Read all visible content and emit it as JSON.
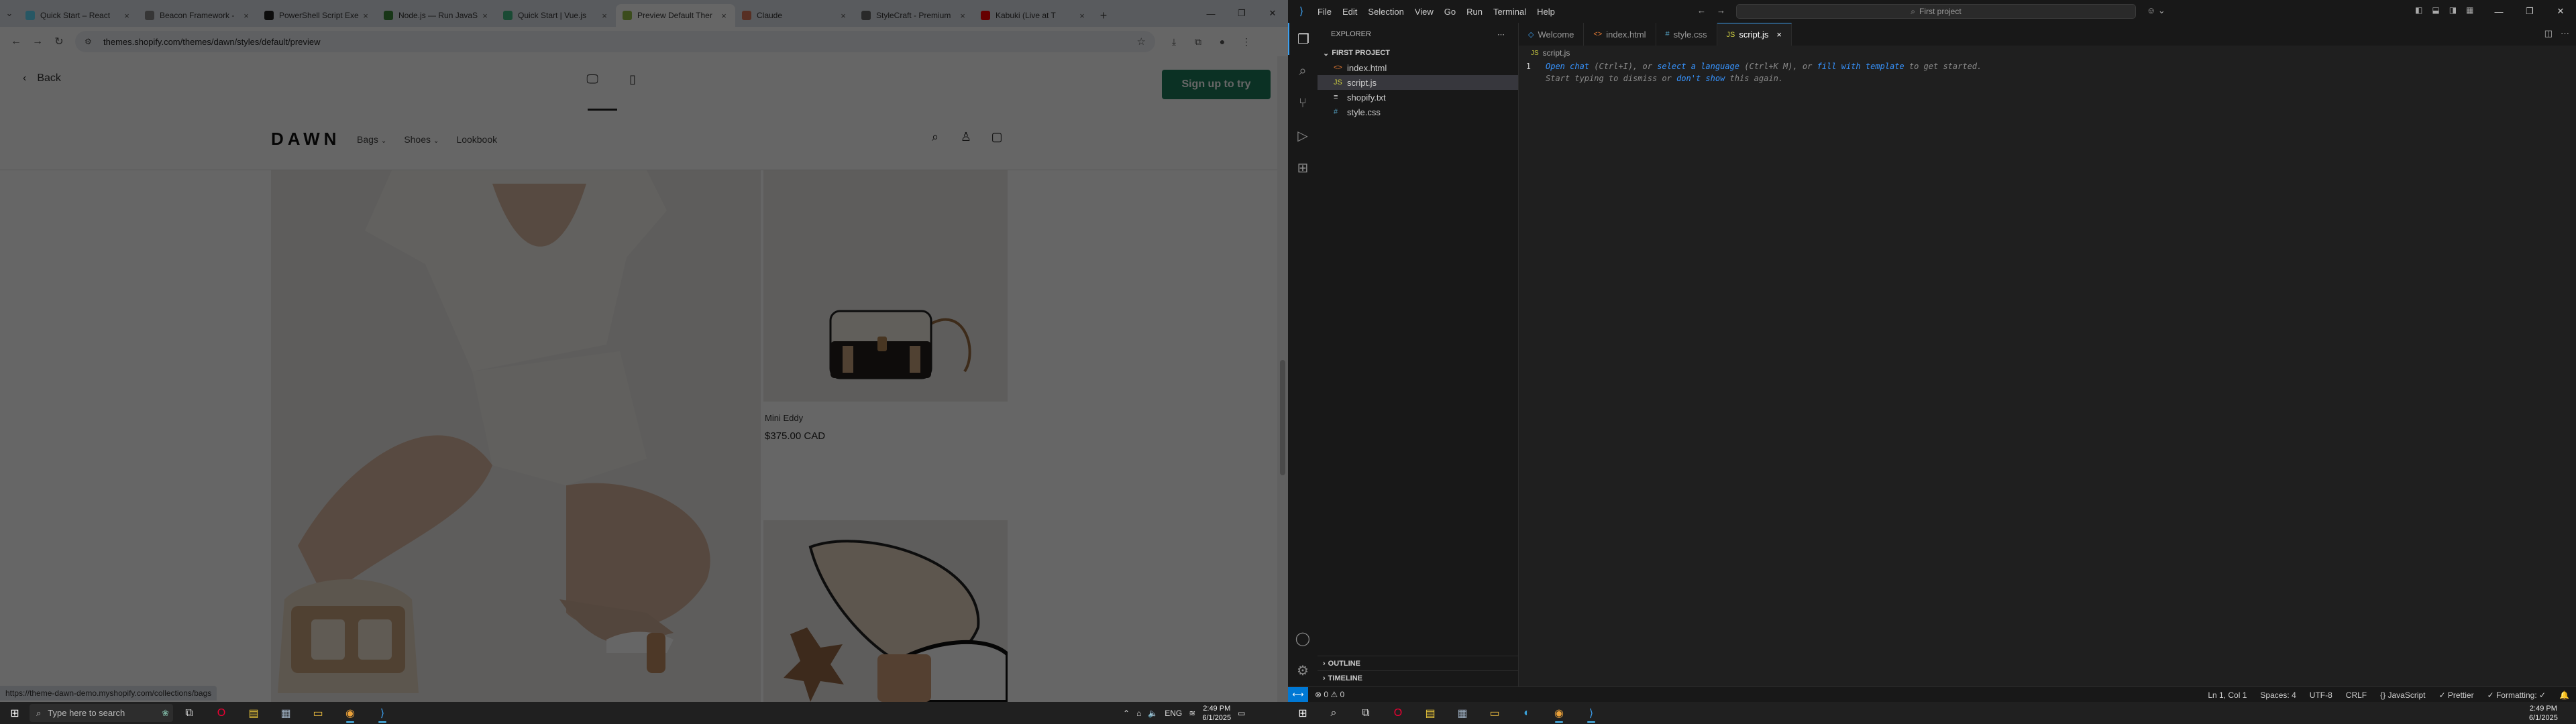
{
  "chrome": {
    "tabs": [
      {
        "title": "Quick Start – React",
        "favicon_color": "#61dafb",
        "active": false
      },
      {
        "title": "Beacon Framework -",
        "favicon_color": "#888888",
        "active": false
      },
      {
        "title": "PowerShell Script Exe",
        "favicon_color": "#222222",
        "active": false
      },
      {
        "title": "Node.js — Run JavaS",
        "favicon_color": "#3c873a",
        "active": false
      },
      {
        "title": "Quick Start | Vue.js",
        "favicon_color": "#41b883",
        "active": false
      },
      {
        "title": "Preview Default Ther",
        "favicon_color": "#95bf47",
        "active": true
      },
      {
        "title": "Claude",
        "favicon_color": "#d97757",
        "active": false
      },
      {
        "title": "StyleCraft - Premium",
        "favicon_color": "#666666",
        "active": false
      },
      {
        "title": "Kabuki (Live at T",
        "favicon_color": "#ff0000",
        "active": false
      }
    ],
    "url": "themes.shopify.com/themes/dawn/styles/default/preview",
    "status_url": "https://theme-dawn-demo.myshopify.com/collections/bags"
  },
  "preview": {
    "back_label": "Back",
    "signup_label": "Sign up to try",
    "store": {
      "logo": "DAWN",
      "nav": [
        "Bags",
        "Shoes",
        "Lookbook"
      ],
      "product_title": "Mini Eddy",
      "product_price": "$375.00 CAD"
    }
  },
  "vscode": {
    "menu": [
      "File",
      "Edit",
      "Selection",
      "View",
      "Go",
      "Run",
      "Terminal",
      "Help"
    ],
    "search_placeholder": "First project",
    "explorer_title": "EXPLORER",
    "project_name": "FIRST PROJECT",
    "files": [
      {
        "name": "index.html",
        "icon": "<>",
        "icon_color": "#e37933"
      },
      {
        "name": "script.js",
        "icon": "JS",
        "icon_color": "#cbcb41"
      },
      {
        "name": "shopify.txt",
        "icon": "≡",
        "icon_color": "#cccccc"
      },
      {
        "name": "style.css",
        "icon": "#",
        "icon_color": "#519aba"
      }
    ],
    "selected_file": "script.js",
    "tabs": [
      {
        "label": "Welcome",
        "icon": "◇",
        "icon_color": "#3ca0f0"
      },
      {
        "label": "index.html",
        "icon": "<>",
        "icon_color": "#e37933"
      },
      {
        "label": "style.css",
        "icon": "#",
        "icon_color": "#519aba"
      },
      {
        "label": "script.js",
        "icon": "JS",
        "icon_color": "#cbcb41",
        "active": true
      }
    ],
    "breadcrumb": "script.js",
    "line_number": "1",
    "hint_parts": {
      "open_chat": "Open chat",
      "p1": " (Ctrl+I), or ",
      "select_language": "select a language",
      "p2": " (Ctrl+K M), or ",
      "fill_template": "fill with template",
      "p3": " to get started.",
      "p4": "Start typing to dismiss or ",
      "dont_show": "don't show",
      "p5": " this again."
    },
    "outline_label": "OUTLINE",
    "timeline_label": "TIMELINE",
    "status": {
      "problems": "⊗ 0 ⚠ 0",
      "position": "Ln 1, Col 1",
      "spaces": "Spaces: 4",
      "encoding": "UTF-8",
      "eol": "CRLF",
      "language": "{} JavaScript",
      "prettier": "✓ Prettier",
      "formatting": "✓ Formatting: ✓"
    }
  },
  "taskbar": {
    "search_placeholder": "Type here to search",
    "lang": "ENG",
    "time_left": "2:49 PM",
    "date_left": "6/1/2025",
    "time_right": "2:49 PM",
    "date_right": "6/1/2025"
  }
}
